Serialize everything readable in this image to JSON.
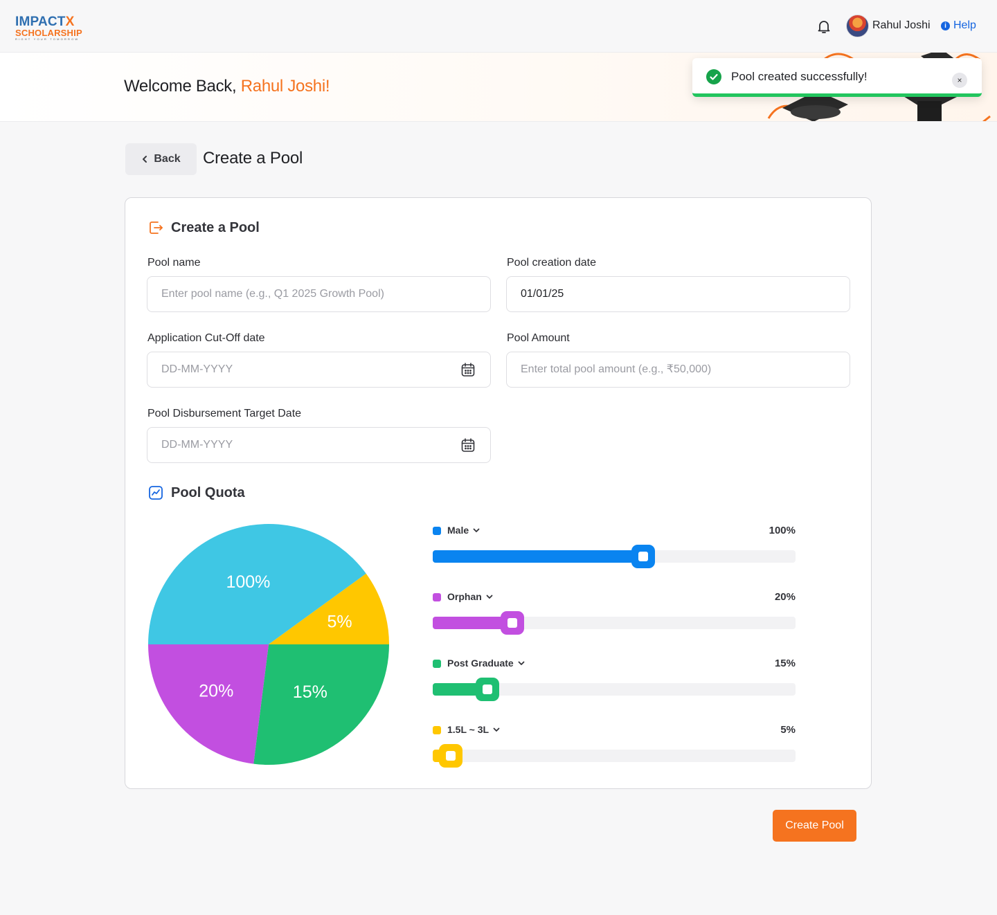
{
  "header": {
    "logo_top": "IMPACT",
    "logo_x": "X",
    "logo_mid": "SCHOLARSHIP",
    "logo_tagline": "RIGHT YOUR TOMORROW",
    "user_name": "Rahul Joshi",
    "help_label": "Help",
    "icons": [
      "bell-icon",
      "avatar",
      "info-icon"
    ]
  },
  "banner": {
    "greeting": "Welcome Back, ",
    "name": "Rahul Joshi!"
  },
  "toast": {
    "message": "Pool created successfully!",
    "close_glyph": "×",
    "accent": "#22c55e"
  },
  "page": {
    "back_label": "Back",
    "title": "Create a Pool"
  },
  "form": {
    "section_title": "Create a Pool",
    "pool_name": {
      "label": "Pool name",
      "value": "",
      "placeholder": "Enter pool name (e.g., Q1 2025 Growth Pool)"
    },
    "pool_creation_date": {
      "label": "Pool creation date",
      "value": "01/01/25",
      "placeholder": ""
    },
    "cutoff_date": {
      "label": "Application Cut-Off date",
      "value": "",
      "placeholder": "DD-MM-YYYY"
    },
    "pool_amount": {
      "label": "Pool Amount",
      "value": "",
      "placeholder": "Enter total pool amount (e.g., ₹50,000)"
    },
    "disbursement_date": {
      "label": "Pool Disbursement Target Date",
      "value": "",
      "placeholder": "DD-MM-YYYY"
    }
  },
  "quota": {
    "section_title": "Pool Quota",
    "items": [
      {
        "name": "Male",
        "display": "100%",
        "fill_fraction": 0.58,
        "color": "#0a84f0"
      },
      {
        "name": "Orphan",
        "display": "20%",
        "fill_fraction": 0.22,
        "color": "#c24fe0"
      },
      {
        "name": "Post Graduate",
        "display": "15%",
        "fill_fraction": 0.15,
        "color": "#1fbf72"
      },
      {
        "name": "1.5L ~ 3L",
        "display": "5%",
        "fill_fraction": 0.05,
        "color": "#ffc700"
      }
    ]
  },
  "chart_data": {
    "type": "pie",
    "slices": [
      {
        "label": "100%",
        "share": 0.4,
        "color": "#3fc7e4"
      },
      {
        "label": "5%",
        "share": 0.1,
        "color": "#ffc700"
      },
      {
        "label": "15%",
        "share": 0.27,
        "color": "#1fbf72"
      },
      {
        "label": "20%",
        "share": 0.23,
        "color": "#c24fe0"
      }
    ]
  },
  "actions": {
    "create_label": "Create Pool",
    "accent": "#f5731f"
  }
}
